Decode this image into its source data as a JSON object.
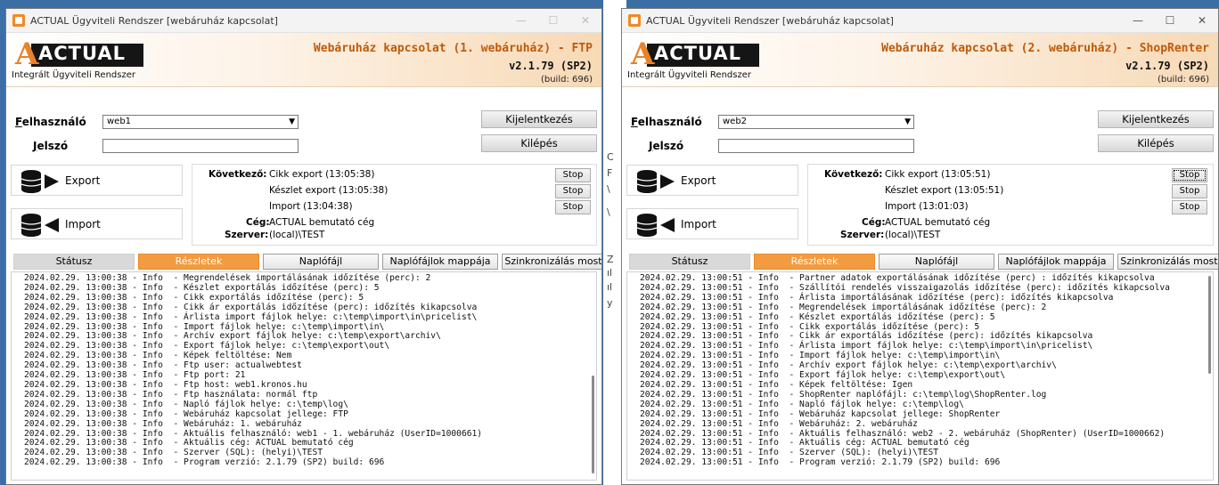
{
  "windows": [
    {
      "title": "ACTUAL Ügyviteli Rendszer [webáruház kapcsolat]",
      "logo_text": "ACTUAL",
      "logo_subtitle": "Integrált Ügyviteli Rendszer",
      "header_title": "Webáruház kapcsolat (1. webáruház) - FTP",
      "version": "v2.1.79 (SP2)",
      "build": "(build: 696)",
      "user_label": "Felhasználó",
      "user_value": "web1",
      "password_label": "Jelszó",
      "logout_label": "Kijelentkezés",
      "exit_label": "Kilépés",
      "export_label": "Export",
      "import_label": "Import",
      "next_label": "Következő:",
      "schedule": [
        {
          "text": "Cikk export (13:05:38)",
          "stop": "Stop"
        },
        {
          "text": "Készlet export (13:05:38)",
          "stop": "Stop"
        },
        {
          "text": "Import (13:04:38)",
          "stop": "Stop"
        }
      ],
      "company_label": "Cég:",
      "company_value": "ACTUAL bemutató cég",
      "server_label": "Szerver:",
      "server_value": "(local)\\TEST",
      "tabs": {
        "status": "Státusz",
        "details": "Részletek",
        "logfile": "Naplófájl",
        "log_folder": "Naplófájlok mappája",
        "sync_now": "Szinkronizálás most"
      },
      "log": [
        "2024.02.29. 13:00:38 - Info  - Megrendelések importálásának időzítése (perc): 2",
        "2024.02.29. 13:00:38 - Info  - Készlet exportálás időzítése (perc): 5",
        "2024.02.29. 13:00:38 - Info  - Cikk exportálás időzítése (perc): 5",
        "2024.02.29. 13:00:38 - Info  - Cikk ár exportálás időzítése (perc): időzítés kikapcsolva",
        "2024.02.29. 13:00:38 - Info  - Árlista import fájlok helye: c:\\temp\\import\\in\\pricelist\\",
        "2024.02.29. 13:00:38 - Info  - Import fájlok helye: c:\\temp\\import\\in\\",
        "2024.02.29. 13:00:38 - Info  - Archív export fájlok helye: c:\\temp\\export\\archiv\\",
        "2024.02.29. 13:00:38 - Info  - Export fájlok helye: c:\\temp\\export\\out\\",
        "2024.02.29. 13:00:38 - Info  - Képek feltöltése: Nem",
        "2024.02.29. 13:00:38 - Info  - Ftp user: actualwebtest",
        "2024.02.29. 13:00:38 - Info  - Ftp port: 21",
        "2024.02.29. 13:00:38 - Info  - Ftp host: web1.kronos.hu",
        "2024.02.29. 13:00:38 - Info  - Ftp használata: normál ftp",
        "2024.02.29. 13:00:38 - Info  - Napló fájlok helye: c:\\temp\\log\\",
        "2024.02.29. 13:00:38 - Info  - Webáruház kapcsolat jellege: FTP",
        "2024.02.29. 13:00:38 - Info  - Webáruház: 1. webáruház",
        "2024.02.29. 13:00:38 - Info  - Aktuális felhasználó: web1 - 1. webáruház (UserID=1000661)",
        "2024.02.29. 13:00:38 - Info  - Aktuális cég: ACTUAL bemutató cég",
        "2024.02.29. 13:00:38 - Info  - Szerver (SQL): (helyi)\\TEST",
        "2024.02.29. 13:00:38 - Info  - Program verzió: 2.1.79 (SP2) build: 696"
      ]
    },
    {
      "title": "ACTUAL Ügyviteli Rendszer [webáruház kapcsolat]",
      "logo_text": "ACTUAL",
      "logo_subtitle": "Integrált Ügyviteli Rendszer",
      "header_title": "Webáruház kapcsolat (2. webáruház) - ShopRenter",
      "version": "v2.1.79 (SP2)",
      "build": "(build: 696)",
      "user_label": "Felhasználó",
      "user_value": "web2",
      "password_label": "Jelszó",
      "logout_label": "Kijelentkezés",
      "exit_label": "Kilépés",
      "export_label": "Export",
      "import_label": "Import",
      "next_label": "Következő:",
      "schedule": [
        {
          "text": "Cikk export (13:05:51)",
          "stop": "Stop"
        },
        {
          "text": "Készlet export (13:05:51)",
          "stop": "Stop"
        },
        {
          "text": "Import (13:01:03)",
          "stop": "Stop"
        }
      ],
      "company_label": "Cég:",
      "company_value": "ACTUAL bemutató cég",
      "server_label": "Szerver:",
      "server_value": "(local)\\TEST",
      "tabs": {
        "status": "Státusz",
        "details": "Részletek",
        "logfile": "Naplófájl",
        "log_folder": "Naplófájlok mappája",
        "sync_now": "Szinkronizálás most"
      },
      "log": [
        "2024.02.29. 13:00:51 - Info  - Partner adatok exportálásának időzítése (perc) : időzítés kikapcsolva",
        "2024.02.29. 13:00:51 - Info  - Szállítói rendelés visszaigazolás időzítése (perc): időzítés kikapcsolva",
        "2024.02.29. 13:00:51 - Info  - Árlista importálásának időzítése (perc): időzítés kikapcsolva",
        "2024.02.29. 13:00:51 - Info  - Megrendelések importálásának időzítése (perc): 2",
        "2024.02.29. 13:00:51 - Info  - Készlet exportálás időzítése (perc): 5",
        "2024.02.29. 13:00:51 - Info  - Cikk exportálás időzítése (perc): 5",
        "2024.02.29. 13:00:51 - Info  - Cikk ár exportálás időzítése (perc): időzítés kikapcsolva",
        "2024.02.29. 13:00:51 - Info  - Árlista import fájlok helye: c:\\temp\\import\\in\\pricelist\\",
        "2024.02.29. 13:00:51 - Info  - Import fájlok helye: c:\\temp\\import\\in\\",
        "2024.02.29. 13:00:51 - Info  - Archív export fájlok helye: c:\\temp\\export\\archiv\\",
        "2024.02.29. 13:00:51 - Info  - Export fájlok helye: c:\\temp\\export\\out\\",
        "2024.02.29. 13:00:51 - Info  - Képek feltöltése: Igen",
        "2024.02.29. 13:00:51 - Info  - ShopRenter naplófájl: c:\\temp\\log\\ShopRenter.log",
        "2024.02.29. 13:00:51 - Info  - Napló fájlok helye: c:\\temp\\log\\",
        "2024.02.29. 13:00:51 - Info  - Webáruház kapcsolat jellege: ShopRenter",
        "2024.02.29. 13:00:51 - Info  - Webáruház: 2. webáruház",
        "2024.02.29. 13:00:51 - Info  - Aktuális felhasználó: web2 - 2. webáruház (ShopRenter) (UserID=1000662)",
        "2024.02.29. 13:00:51 - Info  - Aktuális cég: ACTUAL bemutató cég",
        "2024.02.29. 13:00:51 - Info  - Szerver (SQL): (helyi)\\TEST",
        "2024.02.29. 13:00:51 - Info  - Program verzió: 2.1.79 (SP2) build: 696"
      ]
    }
  ],
  "background_fragments": [
    "C",
    "F",
    "\\",
    "\\",
    "Z",
    "ıl",
    "ıl",
    "y"
  ]
}
